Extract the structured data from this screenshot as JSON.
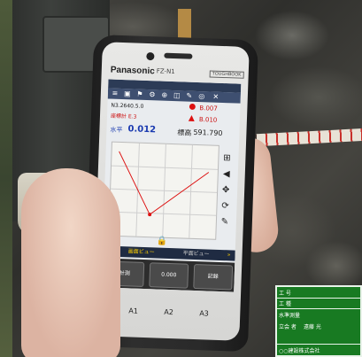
{
  "phone": {
    "brand": "Panasonic",
    "model": "FZ-N1",
    "badge": "TOUGHBOOK"
  },
  "screen": {
    "point_a_label": "B.007",
    "point_b_label": "B.010",
    "horizontal_label": "水平",
    "horizontal_value": "0.012",
    "elevation_label": "標高",
    "elevation_value": "591.790",
    "coord_line_1": "N3.2640.5.0",
    "coord_line_2": "座標計 E.3",
    "tab_left": "画面ビュー",
    "tab_right": "平面ビュー",
    "btn_left": "計測",
    "btn_mid": "0.000",
    "btn_right": "記録"
  },
  "keys": {
    "a1": "A1",
    "a2": "A2",
    "a3": "A3"
  },
  "board": {
    "row1": "工 号",
    "row2": "工 種",
    "row3": "水準測量",
    "row4": "立会 者",
    "row5": "遠藤 光",
    "row6": "○○建設株式会社"
  }
}
